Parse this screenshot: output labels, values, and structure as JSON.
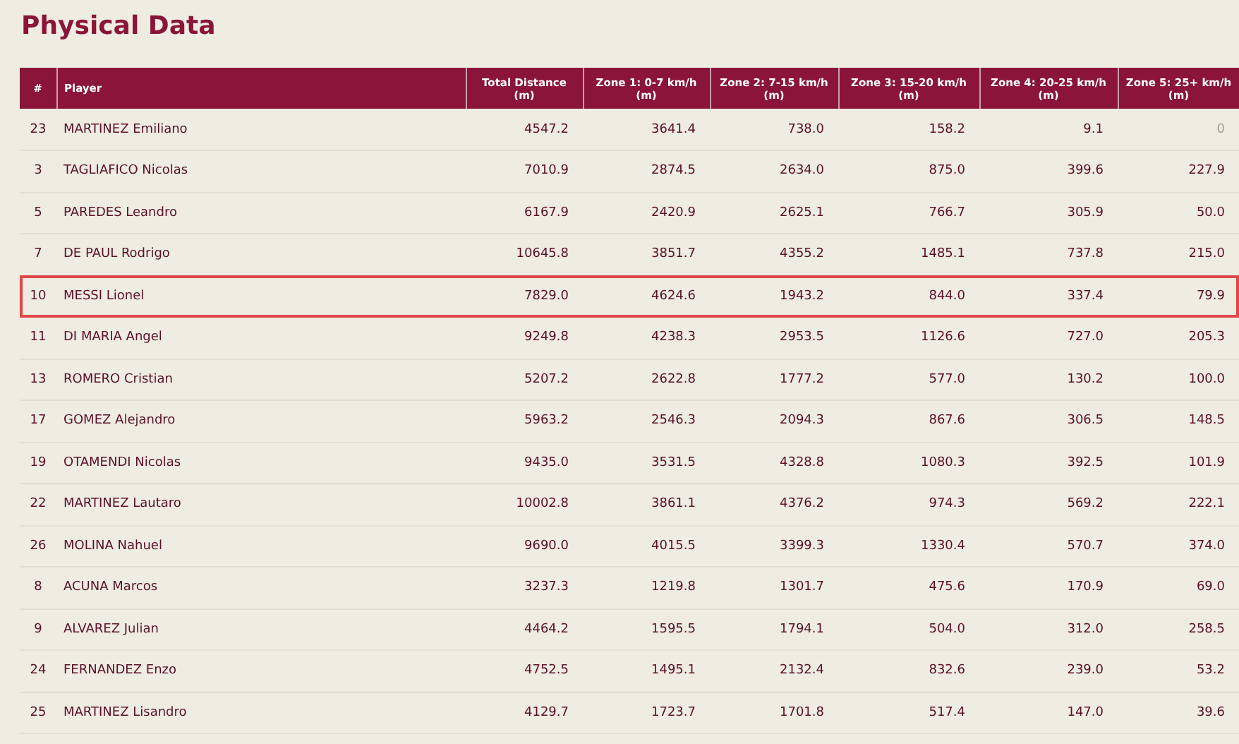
{
  "title": "Physical Data",
  "table": {
    "columns": [
      "#",
      "Player",
      "Total Distance (m)",
      "Zone 1: 0-7 km/h (m)",
      "Zone 2: 7-15 km/h (m)",
      "Zone 3: 15-20 km/h (m)",
      "Zone 4: 20-25 km/h (m)",
      "Zone 5: 25+ km/h (m)"
    ],
    "rows": [
      {
        "cells": [
          "23",
          "MARTINEZ Emiliano",
          "4547.2",
          "3641.4",
          "738.0",
          "158.2",
          "9.1",
          "0"
        ],
        "highlighted": false,
        "last_dimmed": true
      },
      {
        "cells": [
          "3",
          "TAGLIAFICO Nicolas",
          "7010.9",
          "2874.5",
          "2634.0",
          "875.0",
          "399.6",
          "227.9"
        ],
        "highlighted": false,
        "last_dimmed": false
      },
      {
        "cells": [
          "5",
          "PAREDES Leandro",
          "6167.9",
          "2420.9",
          "2625.1",
          "766.7",
          "305.9",
          "50.0"
        ],
        "highlighted": false,
        "last_dimmed": false
      },
      {
        "cells": [
          "7",
          "DE PAUL Rodrigo",
          "10645.8",
          "3851.7",
          "4355.2",
          "1485.1",
          "737.8",
          "215.0"
        ],
        "highlighted": false,
        "last_dimmed": false
      },
      {
        "cells": [
          "10",
          "MESSI Lionel",
          "7829.0",
          "4624.6",
          "1943.2",
          "844.0",
          "337.4",
          "79.9"
        ],
        "highlighted": true,
        "last_dimmed": false
      },
      {
        "cells": [
          "11",
          "DI MARIA Angel",
          "9249.8",
          "4238.3",
          "2953.5",
          "1126.6",
          "727.0",
          "205.3"
        ],
        "highlighted": false,
        "last_dimmed": false
      },
      {
        "cells": [
          "13",
          "ROMERO Cristian",
          "5207.2",
          "2622.8",
          "1777.2",
          "577.0",
          "130.2",
          "100.0"
        ],
        "highlighted": false,
        "last_dimmed": false
      },
      {
        "cells": [
          "17",
          "GOMEZ Alejandro",
          "5963.2",
          "2546.3",
          "2094.3",
          "867.6",
          "306.5",
          "148.5"
        ],
        "highlighted": false,
        "last_dimmed": false
      },
      {
        "cells": [
          "19",
          "OTAMENDI Nicolas",
          "9435.0",
          "3531.5",
          "4328.8",
          "1080.3",
          "392.5",
          "101.9"
        ],
        "highlighted": false,
        "last_dimmed": false
      },
      {
        "cells": [
          "22",
          "MARTINEZ Lautaro",
          "10002.8",
          "3861.1",
          "4376.2",
          "974.3",
          "569.2",
          "222.1"
        ],
        "highlighted": false,
        "last_dimmed": false
      },
      {
        "cells": [
          "26",
          "MOLINA Nahuel",
          "9690.0",
          "4015.5",
          "3399.3",
          "1330.4",
          "570.7",
          "374.0"
        ],
        "highlighted": false,
        "last_dimmed": false
      },
      {
        "cells": [
          "8",
          "ACUNA Marcos",
          "3237.3",
          "1219.8",
          "1301.7",
          "475.6",
          "170.9",
          "69.0"
        ],
        "highlighted": false,
        "last_dimmed": false
      },
      {
        "cells": [
          "9",
          "ALVAREZ Julian",
          "4464.2",
          "1595.5",
          "1794.1",
          "504.0",
          "312.0",
          "258.5"
        ],
        "highlighted": false,
        "last_dimmed": false
      },
      {
        "cells": [
          "24",
          "FERNANDEZ Enzo",
          "4752.5",
          "1495.1",
          "2132.4",
          "832.6",
          "239.0",
          "53.2"
        ],
        "highlighted": false,
        "last_dimmed": false
      },
      {
        "cells": [
          "25",
          "MARTINEZ Lisandro",
          "4129.7",
          "1723.7",
          "1701.8",
          "517.4",
          "147.0",
          "39.6"
        ],
        "highlighted": false,
        "last_dimmed": false
      }
    ]
  }
}
